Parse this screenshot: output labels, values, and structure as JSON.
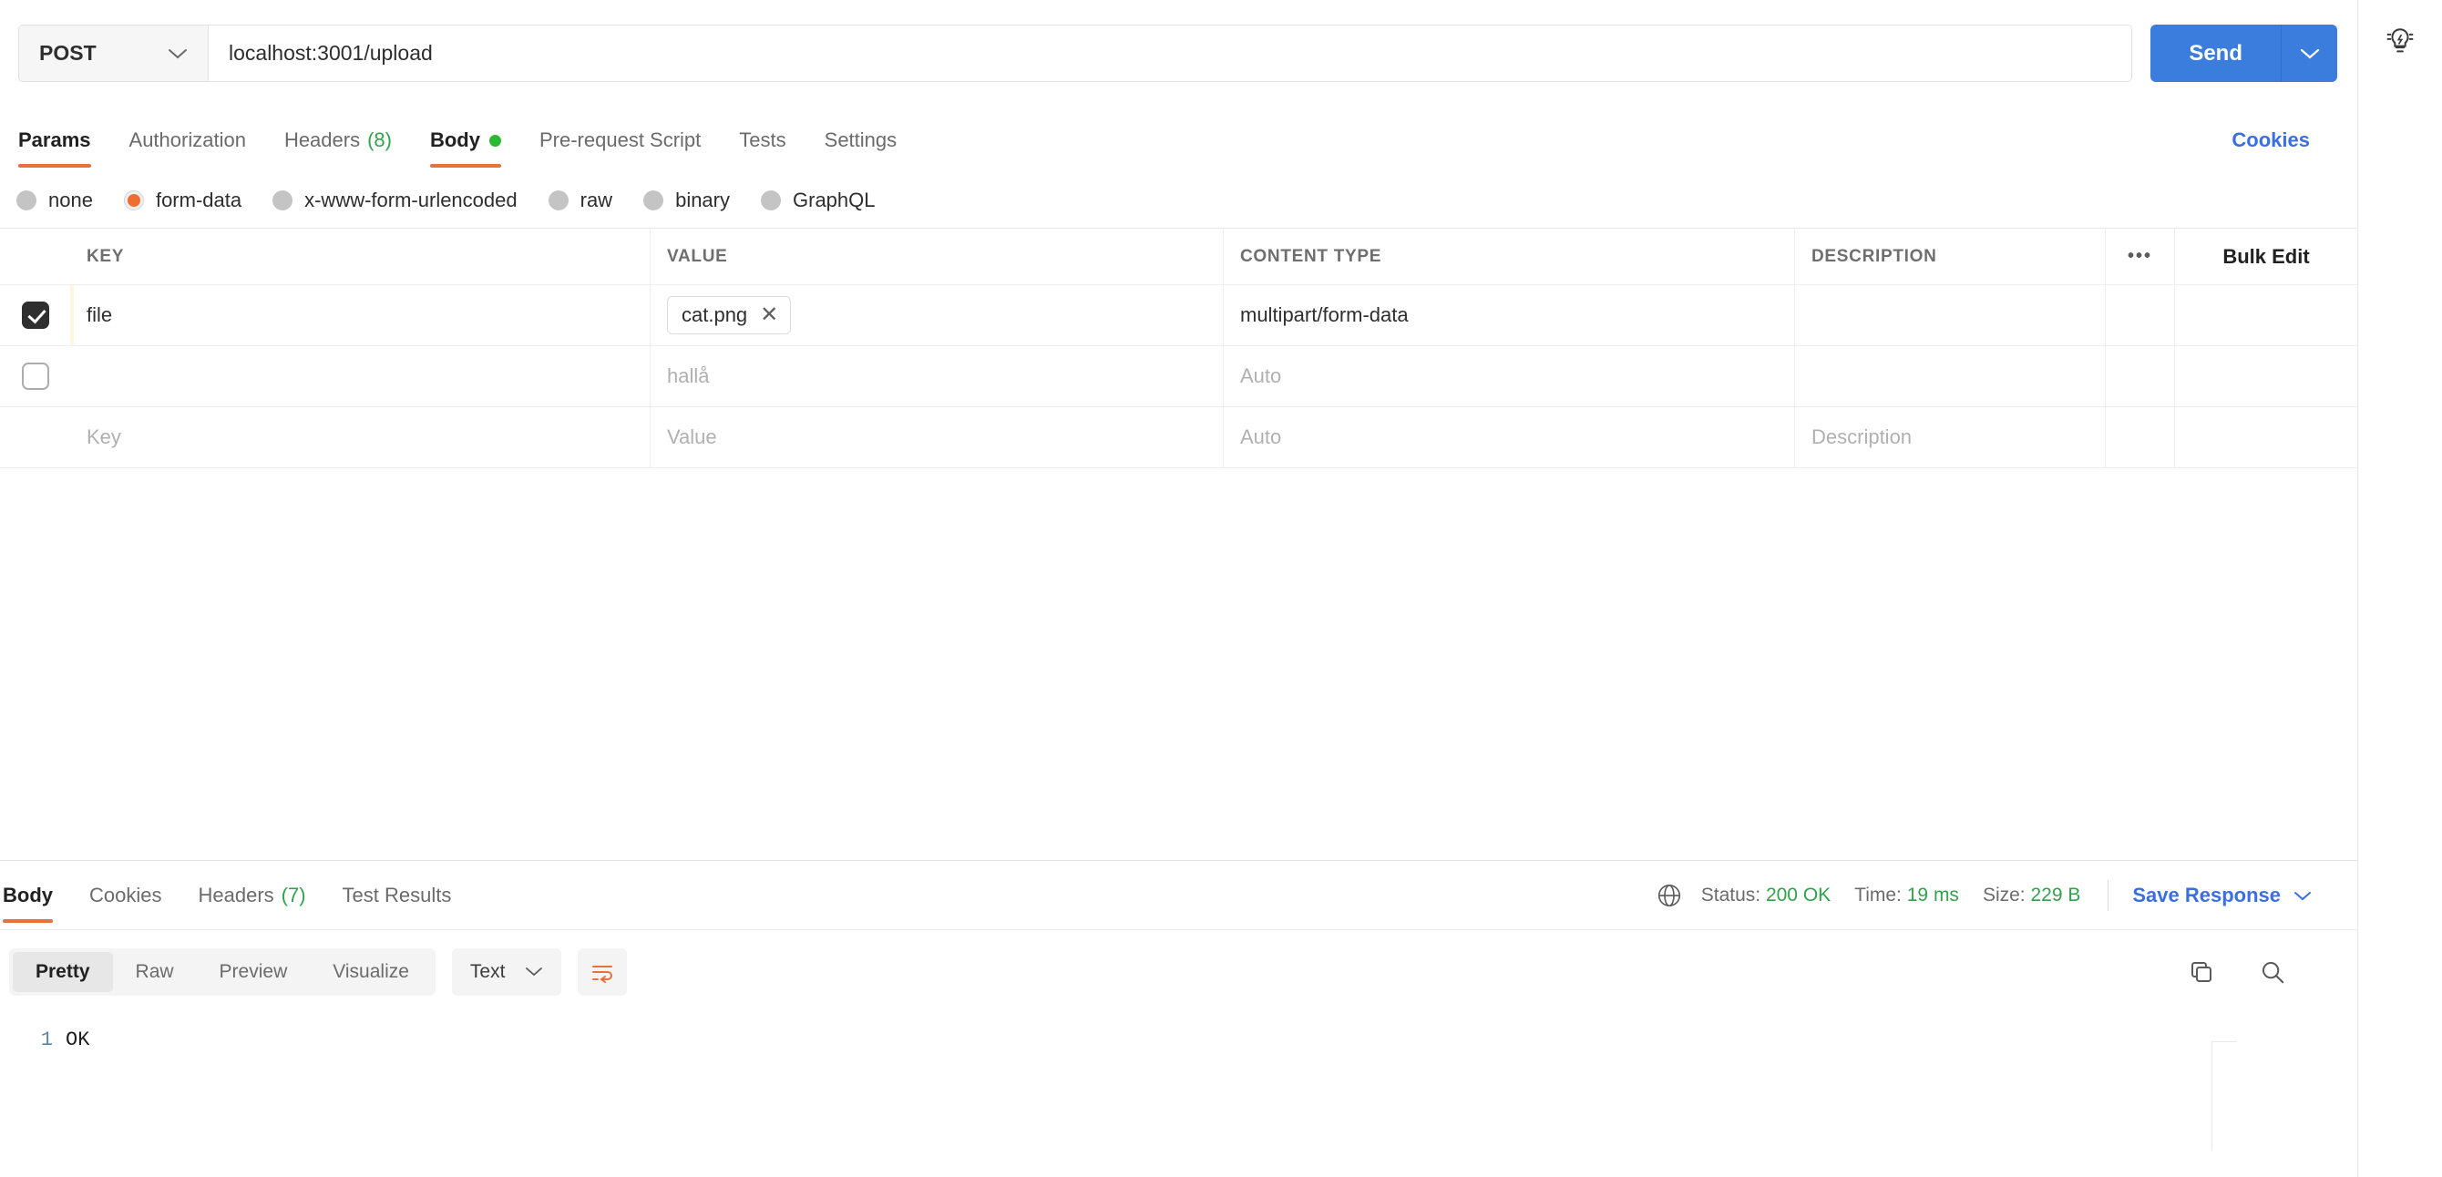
{
  "request": {
    "method": "POST",
    "url": "localhost:3001/upload",
    "send_label": "Send",
    "tabs": [
      {
        "label": "Params",
        "count": "",
        "active": false,
        "dot": false
      },
      {
        "label": "Authorization",
        "count": "",
        "active": false,
        "dot": false
      },
      {
        "label": "Headers",
        "count": "(8)",
        "active": false,
        "dot": false
      },
      {
        "label": "Body",
        "count": "",
        "active": true,
        "dot": true
      },
      {
        "label": "Pre-request Script",
        "count": "",
        "active": false,
        "dot": false
      },
      {
        "label": "Tests",
        "count": "",
        "active": false,
        "dot": false
      },
      {
        "label": "Settings",
        "count": "",
        "active": false,
        "dot": false
      }
    ],
    "cookies_link": "Cookies",
    "body_types": [
      {
        "label": "none",
        "selected": false
      },
      {
        "label": "form-data",
        "selected": true
      },
      {
        "label": "x-www-form-urlencoded",
        "selected": false
      },
      {
        "label": "raw",
        "selected": false
      },
      {
        "label": "binary",
        "selected": false
      },
      {
        "label": "GraphQL",
        "selected": false
      }
    ]
  },
  "table": {
    "headers": {
      "key": "KEY",
      "value": "VALUE",
      "content_type": "CONTENT TYPE",
      "description": "DESCRIPTION",
      "options_icon": "•••",
      "bulk_edit": "Bulk Edit"
    },
    "rows": [
      {
        "checked": true,
        "key": "file",
        "value_chip": "cat.png",
        "value_chip_remove": "✕",
        "content_type": "multipart/form-data",
        "description": ""
      },
      {
        "checked": false,
        "key": "",
        "value_placeholder": "hallå",
        "content_type_placeholder": "Auto",
        "description": ""
      },
      {
        "checked": false,
        "key_placeholder": "Key",
        "value_placeholder": "Value",
        "content_type_placeholder": "Auto",
        "description_placeholder": "Description"
      }
    ]
  },
  "response": {
    "tabs": [
      {
        "label": "Body",
        "count": "",
        "active": true
      },
      {
        "label": "Cookies",
        "count": "",
        "active": false
      },
      {
        "label": "Headers",
        "count": "(7)",
        "active": false
      },
      {
        "label": "Test Results",
        "count": "",
        "active": false
      }
    ],
    "status_label": "Status:",
    "status_value": "200 OK",
    "time_label": "Time:",
    "time_value": "19 ms",
    "size_label": "Size:",
    "size_value": "229 B",
    "save_response": "Save Response",
    "view_modes": [
      {
        "label": "Pretty",
        "active": true
      },
      {
        "label": "Raw",
        "active": false
      },
      {
        "label": "Preview",
        "active": false
      },
      {
        "label": "Visualize",
        "active": false
      }
    ],
    "format": "Text",
    "body_lines": [
      {
        "number": "1",
        "text": "OK"
      }
    ]
  },
  "colors": {
    "accent_orange": "#e8713b",
    "send_blue": "#3b7ddd",
    "link_blue": "#3b6fe0",
    "success_green": "#31a24c"
  }
}
